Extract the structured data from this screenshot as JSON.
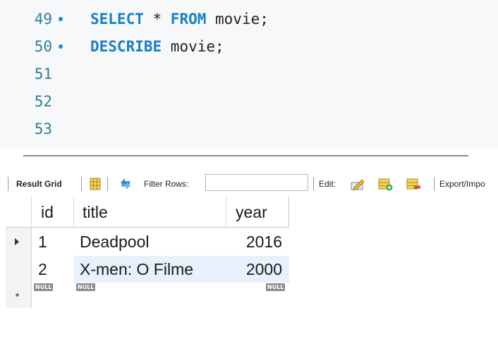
{
  "editor": {
    "lines": [
      {
        "num": "49",
        "kw1": "SELECT",
        "mid": " * ",
        "kw2": "FROM",
        "rest": " movie;",
        "has_dot": true
      },
      {
        "num": "50",
        "kw1": "DESCRIBE",
        "mid": "",
        "kw2": "",
        "rest": " movie;",
        "has_dot": true
      },
      {
        "num": "51"
      },
      {
        "num": "52"
      },
      {
        "num": "53"
      }
    ]
  },
  "toolbar": {
    "result_grid_label": "Result Grid",
    "filter_rows_label": "Filter Rows:",
    "filter_value": "",
    "edit_label": "Edit:",
    "export_label": "Export/Impo",
    "icons": [
      "grid-layout-icon",
      "refresh-icon",
      "edit-row-icon",
      "add-row-icon",
      "delete-row-icon"
    ]
  },
  "grid": {
    "columns": [
      "id",
      "title",
      "year"
    ],
    "rows": [
      {
        "id": "1",
        "title": "Deadpool",
        "year": "2016",
        "current": true
      },
      {
        "id": "2",
        "title": "X-men: O Filme",
        "year": "2000",
        "selected": true
      }
    ],
    "new_row": {
      "id": "NULL",
      "title": "NULL",
      "year": "NULL"
    },
    "new_row_marker": "*",
    "colors": {
      "selected_row": "#e8f0fc",
      "keyword": "#1a7fc1"
    }
  }
}
